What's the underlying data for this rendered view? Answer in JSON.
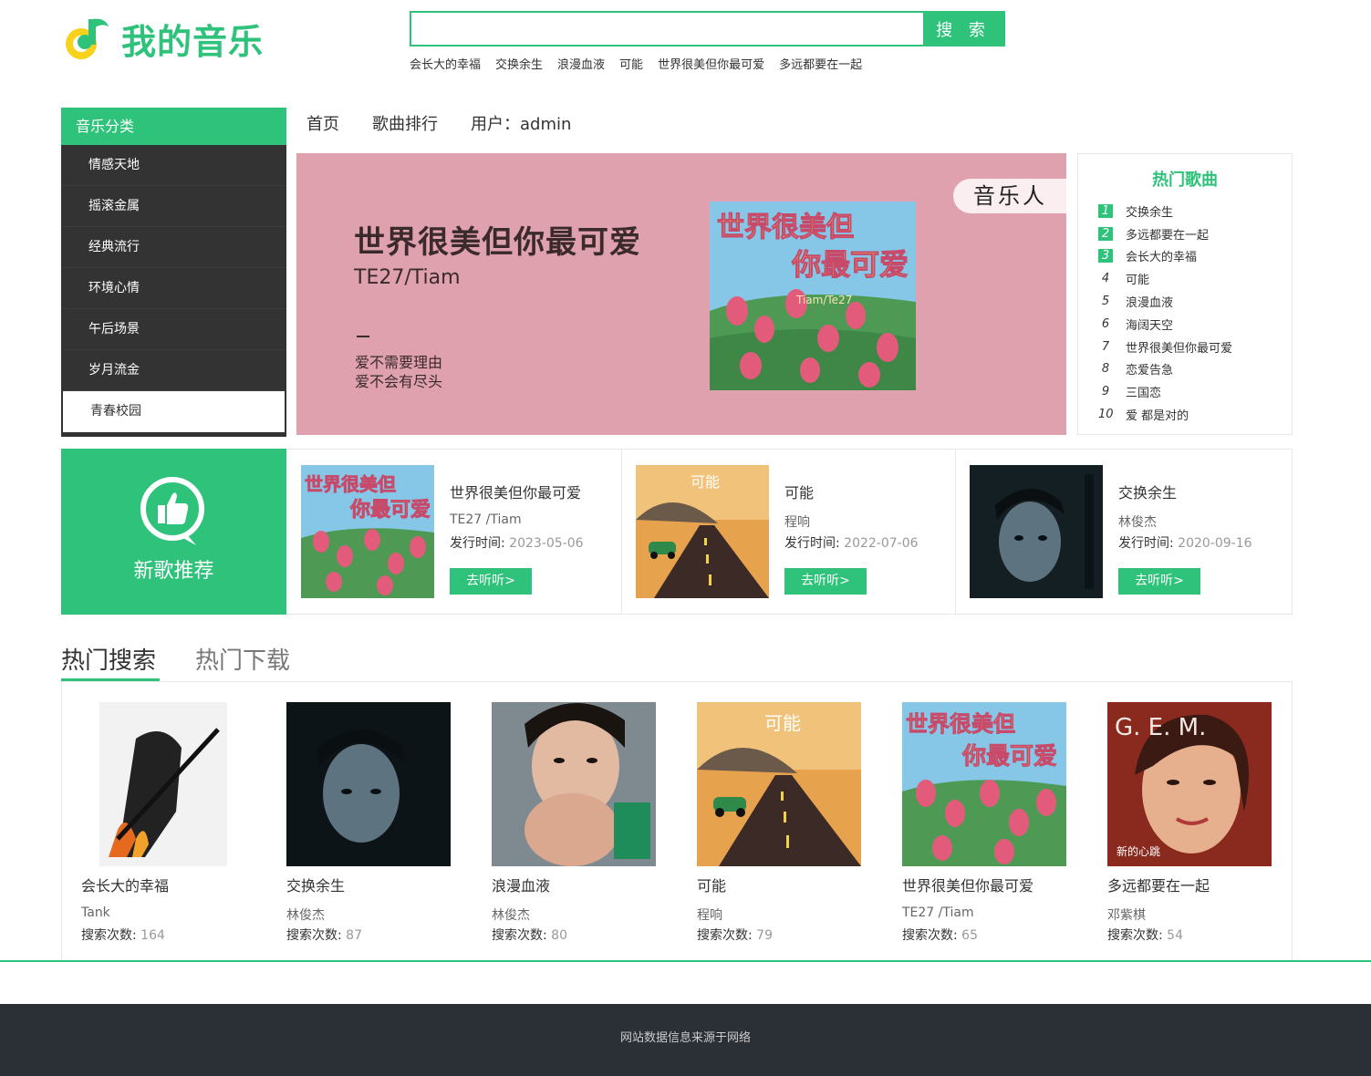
{
  "header": {
    "logo_text": "我的音乐",
    "search": {
      "value": "",
      "placeholder": "",
      "button_label": "搜 索"
    },
    "hot_words": [
      "会长大的幸福",
      "交换余生",
      "浪漫血液",
      "可能",
      "世界很美但你最可爱",
      "多远都要在一起"
    ]
  },
  "categories": {
    "title": "音乐分类",
    "items": [
      "情感天地",
      "摇滚金属",
      "经典流行",
      "环境心情",
      "午后场景",
      "岁月流金",
      "青春校园"
    ],
    "active": "青春校园"
  },
  "nav": {
    "items": [
      "首页",
      "歌曲排行",
      "用户：admin"
    ]
  },
  "banner": {
    "title": "世界很美但你最可爱",
    "artist": "TE27/Tiam",
    "line1": "爱不需要理由",
    "line2": "爱不会有尽头",
    "tag": "音乐人",
    "album_text_top": "世界很美但",
    "album_text_bottom": "你最可爱",
    "album_text_sign": "Tiam/Te27"
  },
  "hot_songs": {
    "title": "热门歌曲",
    "items": [
      {
        "rank": "1",
        "name": "交换余生"
      },
      {
        "rank": "2",
        "name": "多远都要在一起"
      },
      {
        "rank": "3",
        "name": "会长大的幸福"
      },
      {
        "rank": "4",
        "name": "可能"
      },
      {
        "rank": "5",
        "name": "浪漫血液"
      },
      {
        "rank": "6",
        "name": "海阔天空"
      },
      {
        "rank": "7",
        "name": "世界很美但你最可爱"
      },
      {
        "rank": "8",
        "name": "恋爱告急"
      },
      {
        "rank": "9",
        "name": "三国恋"
      },
      {
        "rank": "10",
        "name": "爱 都是对的"
      }
    ]
  },
  "new_songs": {
    "label": "新歌推荐",
    "date_label": "发行时间:",
    "button_label": "去听听>",
    "items": [
      {
        "name": "世界很美但你最可爱",
        "artist": "TE27 /Tiam",
        "date": "2023-05-06"
      },
      {
        "name": "可能",
        "artist": "程响",
        "date": "2022-07-06"
      },
      {
        "name": "交换余生",
        "artist": "林俊杰",
        "date": "2020-09-16"
      }
    ]
  },
  "tabs": {
    "active": "热门搜索",
    "inactive": "热门下载"
  },
  "hot_search": {
    "count_label": "搜索次数:",
    "items": [
      {
        "name": "会长大的幸福",
        "artist": "Tank",
        "count": "164"
      },
      {
        "name": "交换余生",
        "artist": "林俊杰",
        "count": "87"
      },
      {
        "name": "浪漫血液",
        "artist": "林俊杰",
        "count": "80"
      },
      {
        "name": "可能",
        "artist": "程响",
        "count": "79"
      },
      {
        "name": "世界很美但你最可爱",
        "artist": "TE27 /Tiam",
        "count": "65"
      },
      {
        "name": "多远都要在一起",
        "artist": "邓紫棋",
        "count": "54"
      }
    ]
  },
  "cover_text": {
    "keneng": "可能",
    "gem_letters": "G.  E.  M.",
    "gem_sub": "新的心跳"
  },
  "footer": {
    "text": "网站数据信息来源于网络"
  },
  "colors": {
    "accent": "#2fc27a",
    "sidebar": "#333333",
    "banner_bg": "#e0a1ae",
    "footer_bg": "#2b2f36"
  }
}
